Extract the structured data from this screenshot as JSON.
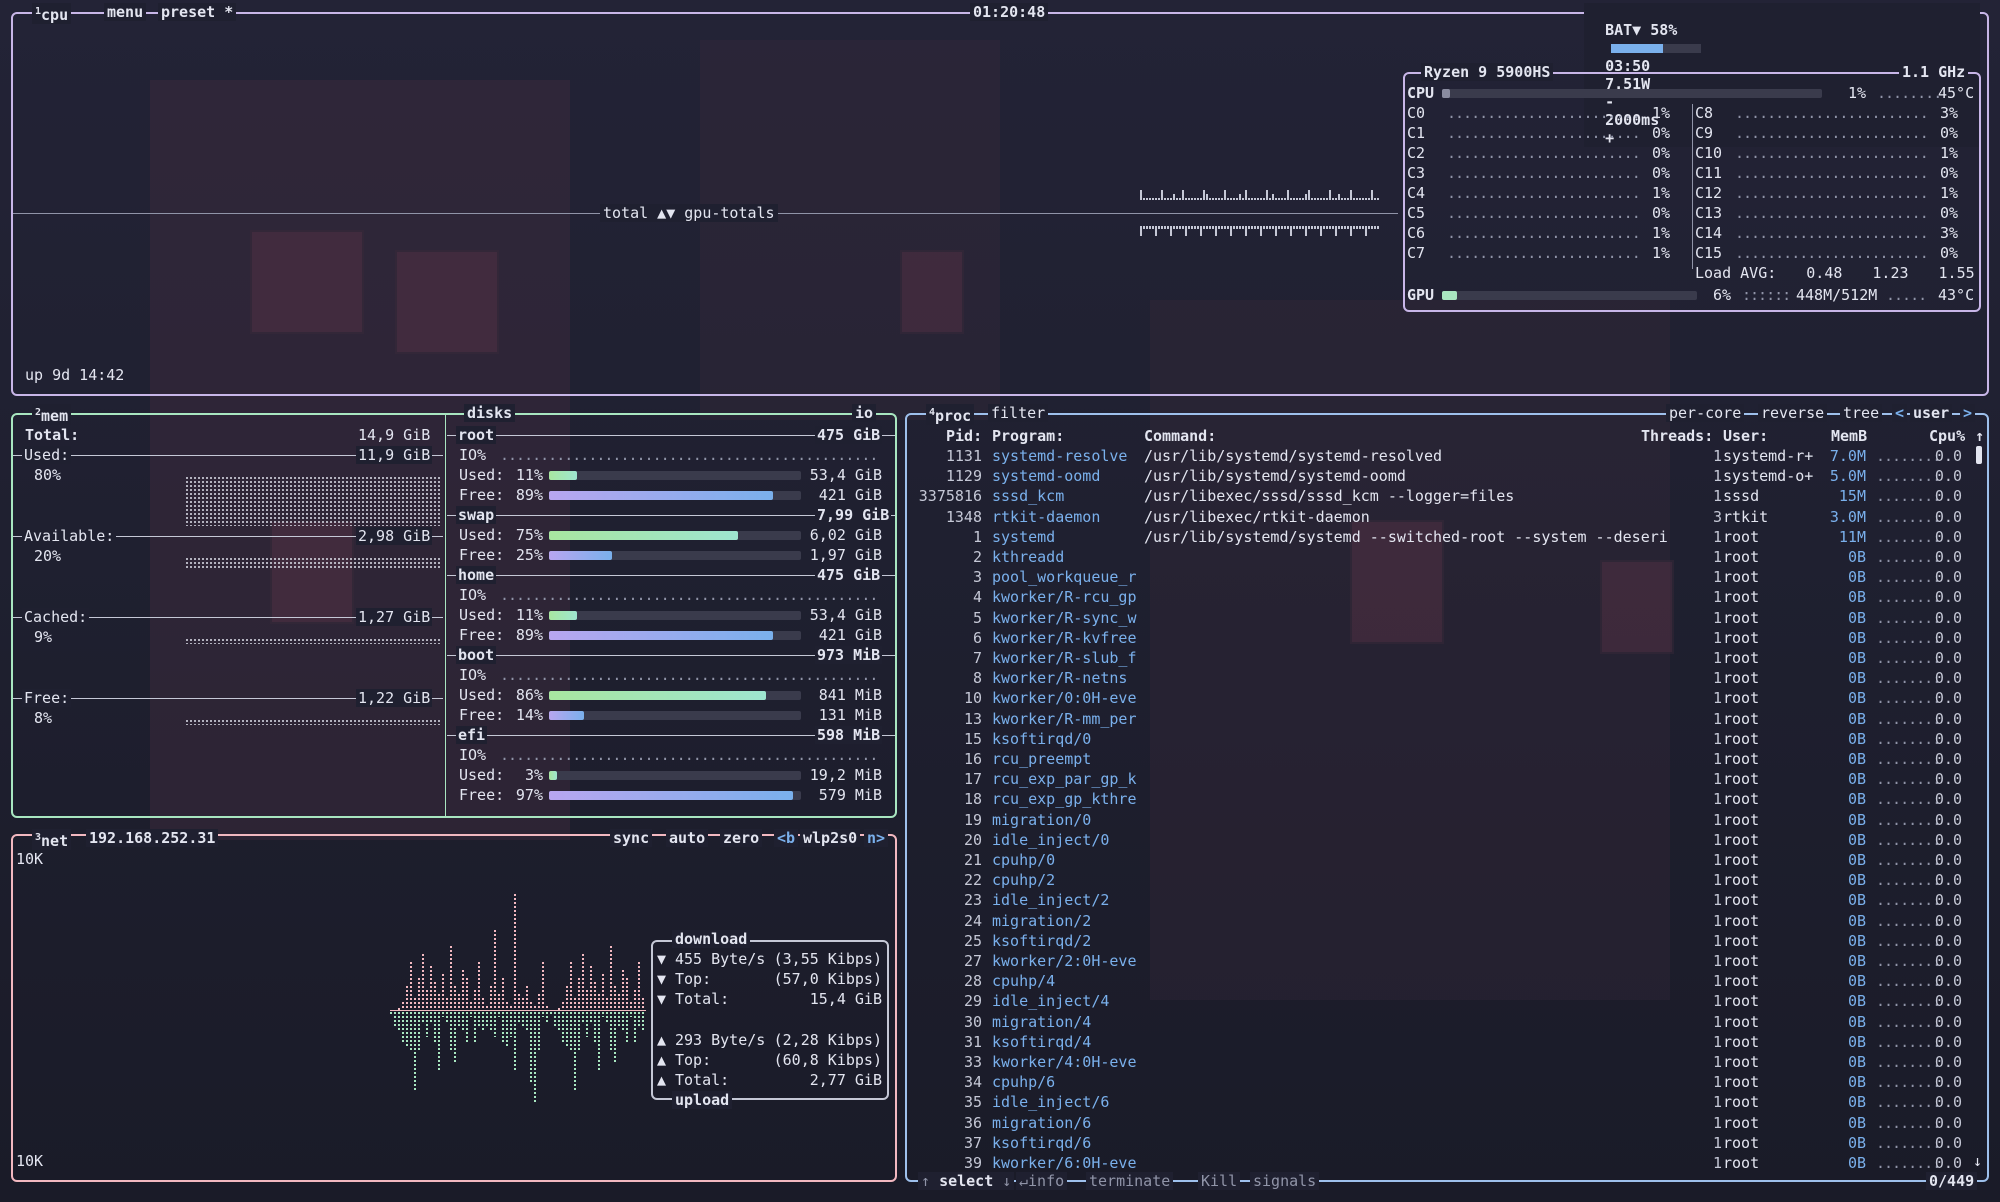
{
  "colors": {
    "cpu": "#c8b6e8",
    "mem": "#a8e6c0",
    "net": "#f2b8c0",
    "proc": "#9ec0ec",
    "meter_green": "#a8e6a0",
    "meter_purple": "#b8a6f0",
    "meter_blue": "#7ab0ec"
  },
  "cpu_box": {
    "tab_num": "1",
    "tab_label": "cpu",
    "menu": "menu",
    "preset": "preset *",
    "clock": "01:20:48",
    "battery": {
      "label": "BAT▼ 58%",
      "percent": 58,
      "time": "03:50",
      "power": "7.51W",
      "interval": "2000ms",
      "minus": "-",
      "plus": "+"
    },
    "graph_label": "total ▲▼ gpu-totals",
    "uptime": "up 9d 14:42",
    "cpu_name": "Ryzen 9 5900HS",
    "freq": "1.1 GHz",
    "total": {
      "label": "CPU",
      "percent": 1,
      "value": "1%",
      "temp": "45°C"
    },
    "cores_left": [
      {
        "label": "C0",
        "value": "1%"
      },
      {
        "label": "C1",
        "value": "0%"
      },
      {
        "label": "C2",
        "value": "0%"
      },
      {
        "label": "C3",
        "value": "0%"
      },
      {
        "label": "C4",
        "value": "1%"
      },
      {
        "label": "C5",
        "value": "0%"
      },
      {
        "label": "C6",
        "value": "1%"
      },
      {
        "label": "C7",
        "value": "1%"
      }
    ],
    "cores_right": [
      {
        "label": "C8",
        "value": "3%"
      },
      {
        "label": "C9",
        "value": "0%"
      },
      {
        "label": "C10",
        "value": "1%"
      },
      {
        "label": "C11",
        "value": "0%"
      },
      {
        "label": "C12",
        "value": "1%"
      },
      {
        "label": "C13",
        "value": "0%"
      },
      {
        "label": "C14",
        "value": "3%"
      },
      {
        "label": "C15",
        "value": "0%"
      }
    ],
    "load_label": "Load AVG:",
    "load": [
      "0.48",
      "1.23",
      "1.55"
    ],
    "gpu": {
      "label": "GPU",
      "percent": 6,
      "value": "6%",
      "mem": "448M/512M",
      "temp": "43°C"
    }
  },
  "mem_box": {
    "tab_num": "2",
    "tab_label": "mem",
    "disks_label": "disks",
    "io_label": "io",
    "total_label": "Total:",
    "total": "14,9 GiB",
    "items": [
      {
        "label": "Used:",
        "value": "11,9 GiB",
        "pct": "80%"
      },
      {
        "label": "Available:",
        "value": "2,98 GiB",
        "pct": "20%"
      },
      {
        "label": "Cached:",
        "value": "1,27 GiB",
        "pct": "9%"
      },
      {
        "label": "Free:",
        "value": "1,22 GiB",
        "pct": "8%"
      }
    ],
    "disks": [
      {
        "name": "root",
        "size": "475 GiB",
        "io": "IO%",
        "used_label": "Used:",
        "used_pct": "11%",
        "used_frac": 0.11,
        "used": "53,4 GiB",
        "free_label": "Free:",
        "free_pct": "89%",
        "free_frac": 0.89,
        "free": "421 GiB"
      },
      {
        "name": "swap",
        "size": "7,99 GiB",
        "io": "",
        "used_label": "Used:",
        "used_pct": "75%",
        "used_frac": 0.75,
        "used": "6,02 GiB",
        "free_label": "Free:",
        "free_pct": "25%",
        "free_frac": 0.25,
        "free": "1,97 GiB"
      },
      {
        "name": "home",
        "size": "475 GiB",
        "io": "IO%",
        "used_label": "Used:",
        "used_pct": "11%",
        "used_frac": 0.11,
        "used": "53,4 GiB",
        "free_label": "Free:",
        "free_pct": "89%",
        "free_frac": 0.89,
        "free": "421 GiB"
      },
      {
        "name": "boot",
        "size": "973 MiB",
        "io": "IO%",
        "used_label": "Used:",
        "used_pct": "86%",
        "used_frac": 0.86,
        "used": "841 MiB",
        "free_label": "Free:",
        "free_pct": "14%",
        "free_frac": 0.14,
        "free": "131 MiB"
      },
      {
        "name": "efi",
        "size": "598 MiB",
        "io": "IO%",
        "used_label": "Used:",
        "used_pct": "3%",
        "used_frac": 0.03,
        "used": "19,2 MiB",
        "free_label": "Free:",
        "free_pct": "97%",
        "free_frac": 0.97,
        "free": "579 MiB"
      }
    ]
  },
  "net_box": {
    "tab_num": "3",
    "tab_label": "net",
    "address": "192.168.252.31",
    "sync": "sync",
    "auto": "auto",
    "zero": "zero",
    "prev": "<b",
    "iface": "wlp2s0",
    "next": "n>",
    "scale_top": "10K",
    "scale_bottom": "10K",
    "download_label": "download",
    "upload_label": "upload",
    "down": [
      {
        "arrow": "▼",
        "label": "455 Byte/s",
        "value": "(3,55 Kibps)"
      },
      {
        "arrow": "▼",
        "label": "Top:",
        "value": "(57,0 Kibps)"
      },
      {
        "arrow": "▼",
        "label": "Total:",
        "value": "15,4 GiB"
      }
    ],
    "up": [
      {
        "arrow": "▲",
        "label": "293 Byte/s",
        "value": "(2,28 Kibps)"
      },
      {
        "arrow": "▲",
        "label": "Top:",
        "value": "(60,8 Kibps)"
      },
      {
        "arrow": "▲",
        "label": "Total:",
        "value": "2,77 GiB"
      }
    ]
  },
  "proc_box": {
    "tab_num": "4",
    "tab_label": "proc",
    "filter": "filter",
    "opts": {
      "percore": "per-core",
      "reverse": "reverse",
      "tree": "tree",
      "left": "<",
      "user": "user",
      "right": ">"
    },
    "cols": {
      "pid": "Pid:",
      "program": "Program:",
      "command": "Command:",
      "threads": "Threads:",
      "user": "User:",
      "mem": "MemB",
      "cpu": "Cpu%"
    },
    "sort_arrow": "↑",
    "rows": [
      {
        "pid": "1131",
        "prog": "systemd-resolve",
        "cmd": "/usr/lib/systemd/systemd-resolved",
        "thr": "1",
        "user": "systemd-r+",
        "mem": "7.0M",
        "cpu": "0.0"
      },
      {
        "pid": "1129",
        "prog": "systemd-oomd",
        "cmd": "/usr/lib/systemd/systemd-oomd",
        "thr": "1",
        "user": "systemd-o+",
        "mem": "5.0M",
        "cpu": "0.0"
      },
      {
        "pid": "3375816",
        "prog": "sssd_kcm",
        "cmd": "/usr/libexec/sssd/sssd_kcm --logger=files",
        "thr": "1",
        "user": "sssd",
        "mem": "15M",
        "cpu": "0.0"
      },
      {
        "pid": "1348",
        "prog": "rtkit-daemon",
        "cmd": "/usr/libexec/rtkit-daemon",
        "thr": "3",
        "user": "rtkit",
        "mem": "3.0M",
        "cpu": "0.0"
      },
      {
        "pid": "1",
        "prog": "systemd",
        "cmd": "/usr/lib/systemd/systemd --switched-root --system --deseri",
        "thr": "1",
        "user": "root",
        "mem": "11M",
        "cpu": "0.0"
      },
      {
        "pid": "2",
        "prog": "kthreadd",
        "cmd": "",
        "thr": "1",
        "user": "root",
        "mem": "0B",
        "cpu": "0.0"
      },
      {
        "pid": "3",
        "prog": "pool_workqueue_r",
        "cmd": "",
        "thr": "1",
        "user": "root",
        "mem": "0B",
        "cpu": "0.0"
      },
      {
        "pid": "4",
        "prog": "kworker/R-rcu_gp",
        "cmd": "",
        "thr": "1",
        "user": "root",
        "mem": "0B",
        "cpu": "0.0"
      },
      {
        "pid": "5",
        "prog": "kworker/R-sync_w",
        "cmd": "",
        "thr": "1",
        "user": "root",
        "mem": "0B",
        "cpu": "0.0"
      },
      {
        "pid": "6",
        "prog": "kworker/R-kvfree",
        "cmd": "",
        "thr": "1",
        "user": "root",
        "mem": "0B",
        "cpu": "0.0"
      },
      {
        "pid": "7",
        "prog": "kworker/R-slub_f",
        "cmd": "",
        "thr": "1",
        "user": "root",
        "mem": "0B",
        "cpu": "0.0"
      },
      {
        "pid": "8",
        "prog": "kworker/R-netns",
        "cmd": "",
        "thr": "1",
        "user": "root",
        "mem": "0B",
        "cpu": "0.0"
      },
      {
        "pid": "10",
        "prog": "kworker/0:0H-eve",
        "cmd": "",
        "thr": "1",
        "user": "root",
        "mem": "0B",
        "cpu": "0.0"
      },
      {
        "pid": "13",
        "prog": "kworker/R-mm_per",
        "cmd": "",
        "thr": "1",
        "user": "root",
        "mem": "0B",
        "cpu": "0.0"
      },
      {
        "pid": "15",
        "prog": "ksoftirqd/0",
        "cmd": "",
        "thr": "1",
        "user": "root",
        "mem": "0B",
        "cpu": "0.0"
      },
      {
        "pid": "16",
        "prog": "rcu_preempt",
        "cmd": "",
        "thr": "1",
        "user": "root",
        "mem": "0B",
        "cpu": "0.0"
      },
      {
        "pid": "17",
        "prog": "rcu_exp_par_gp_k",
        "cmd": "",
        "thr": "1",
        "user": "root",
        "mem": "0B",
        "cpu": "0.0"
      },
      {
        "pid": "18",
        "prog": "rcu_exp_gp_kthre",
        "cmd": "",
        "thr": "1",
        "user": "root",
        "mem": "0B",
        "cpu": "0.0"
      },
      {
        "pid": "19",
        "prog": "migration/0",
        "cmd": "",
        "thr": "1",
        "user": "root",
        "mem": "0B",
        "cpu": "0.0"
      },
      {
        "pid": "20",
        "prog": "idle_inject/0",
        "cmd": "",
        "thr": "1",
        "user": "root",
        "mem": "0B",
        "cpu": "0.0"
      },
      {
        "pid": "21",
        "prog": "cpuhp/0",
        "cmd": "",
        "thr": "1",
        "user": "root",
        "mem": "0B",
        "cpu": "0.0"
      },
      {
        "pid": "22",
        "prog": "cpuhp/2",
        "cmd": "",
        "thr": "1",
        "user": "root",
        "mem": "0B",
        "cpu": "0.0"
      },
      {
        "pid": "23",
        "prog": "idle_inject/2",
        "cmd": "",
        "thr": "1",
        "user": "root",
        "mem": "0B",
        "cpu": "0.0"
      },
      {
        "pid": "24",
        "prog": "migration/2",
        "cmd": "",
        "thr": "1",
        "user": "root",
        "mem": "0B",
        "cpu": "0.0"
      },
      {
        "pid": "25",
        "prog": "ksoftirqd/2",
        "cmd": "",
        "thr": "1",
        "user": "root",
        "mem": "0B",
        "cpu": "0.0"
      },
      {
        "pid": "27",
        "prog": "kworker/2:0H-eve",
        "cmd": "",
        "thr": "1",
        "user": "root",
        "mem": "0B",
        "cpu": "0.0"
      },
      {
        "pid": "28",
        "prog": "cpuhp/4",
        "cmd": "",
        "thr": "1",
        "user": "root",
        "mem": "0B",
        "cpu": "0.0"
      },
      {
        "pid": "29",
        "prog": "idle_inject/4",
        "cmd": "",
        "thr": "1",
        "user": "root",
        "mem": "0B",
        "cpu": "0.0"
      },
      {
        "pid": "30",
        "prog": "migration/4",
        "cmd": "",
        "thr": "1",
        "user": "root",
        "mem": "0B",
        "cpu": "0.0"
      },
      {
        "pid": "31",
        "prog": "ksoftirqd/4",
        "cmd": "",
        "thr": "1",
        "user": "root",
        "mem": "0B",
        "cpu": "0.0"
      },
      {
        "pid": "33",
        "prog": "kworker/4:0H-eve",
        "cmd": "",
        "thr": "1",
        "user": "root",
        "mem": "0B",
        "cpu": "0.0"
      },
      {
        "pid": "34",
        "prog": "cpuhp/6",
        "cmd": "",
        "thr": "1",
        "user": "root",
        "mem": "0B",
        "cpu": "0.0"
      },
      {
        "pid": "35",
        "prog": "idle_inject/6",
        "cmd": "",
        "thr": "1",
        "user": "root",
        "mem": "0B",
        "cpu": "0.0"
      },
      {
        "pid": "36",
        "prog": "migration/6",
        "cmd": "",
        "thr": "1",
        "user": "root",
        "mem": "0B",
        "cpu": "0.0"
      },
      {
        "pid": "37",
        "prog": "ksoftirqd/6",
        "cmd": "",
        "thr": "1",
        "user": "root",
        "mem": "0B",
        "cpu": "0.0"
      },
      {
        "pid": "39",
        "prog": "kworker/6:0H-eve",
        "cmd": "",
        "thr": "1",
        "user": "root",
        "mem": "0B",
        "cpu": "0.0"
      }
    ],
    "footer": {
      "up": "↑",
      "select": "select",
      "down": "↓",
      "info_key": "↵",
      "info": "info",
      "term_key": "t",
      "terminate": "terminate",
      "kill": "Kill",
      "signals": "signals",
      "count": "0/449",
      "scroll_down": "↓"
    }
  }
}
